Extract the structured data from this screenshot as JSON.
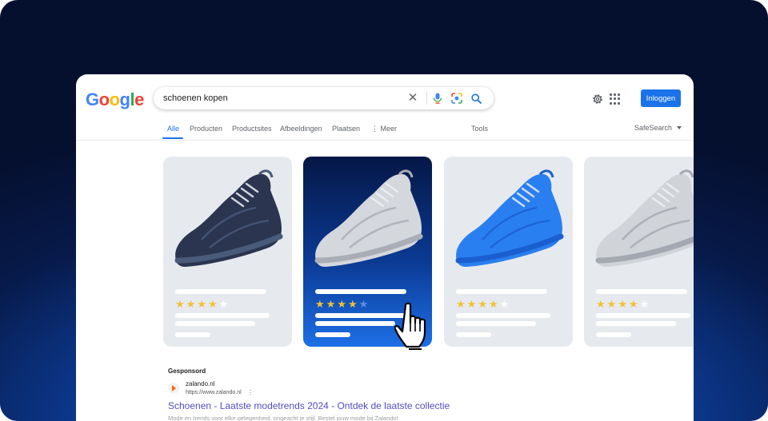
{
  "search": {
    "query": "schoenen kopen"
  },
  "header": {
    "logo": [
      "G",
      "o",
      "o",
      "g",
      "l",
      "e"
    ],
    "login_label": "Inloggen"
  },
  "tabs": [
    {
      "label": "Alle",
      "active": true
    },
    {
      "label": "Producten",
      "active": false
    },
    {
      "label": "Productsites",
      "active": false
    },
    {
      "label": "Afbeeldingen",
      "active": false
    },
    {
      "label": "Plaatsen",
      "active": false
    },
    {
      "label": "⋮ Meer",
      "active": false
    }
  ],
  "tools_label": "Tools",
  "safesearch_label": "SafeSearch",
  "products": [
    {
      "shoe_color": "#2b3550",
      "accent": "#4a5a7a",
      "rating": 4,
      "selected": false
    },
    {
      "shoe_color": "#d4d7dc",
      "accent": "#a9adb5",
      "rating": 4,
      "selected": true
    },
    {
      "shoe_color": "#2a7ff0",
      "accent": "#1a5fd0",
      "rating": 4,
      "selected": false
    },
    {
      "shoe_color": "#d0d3d8",
      "accent": "#a4a8b0",
      "rating": 4,
      "selected": false
    }
  ],
  "star_colors": {
    "filled": "#f2c033",
    "empty": "#ffffff",
    "empty_selected": "#5b8ee8"
  },
  "sponsored": {
    "heading": "Gesponsord",
    "site_name": "zalando.nl",
    "site_url": "https://www.zalando.nl",
    "title": "Schoenen - Laatste modetrends 2024 - Ontdek de laatste collectie",
    "snippet": "Mode en trends voor elke gelegenheid, ongeacht je stijl. Bestel jouw mode bij Zalando!"
  },
  "colors": {
    "accent": "#1a73e8",
    "link": "#1a0dab",
    "zalando": "#ff6900"
  }
}
